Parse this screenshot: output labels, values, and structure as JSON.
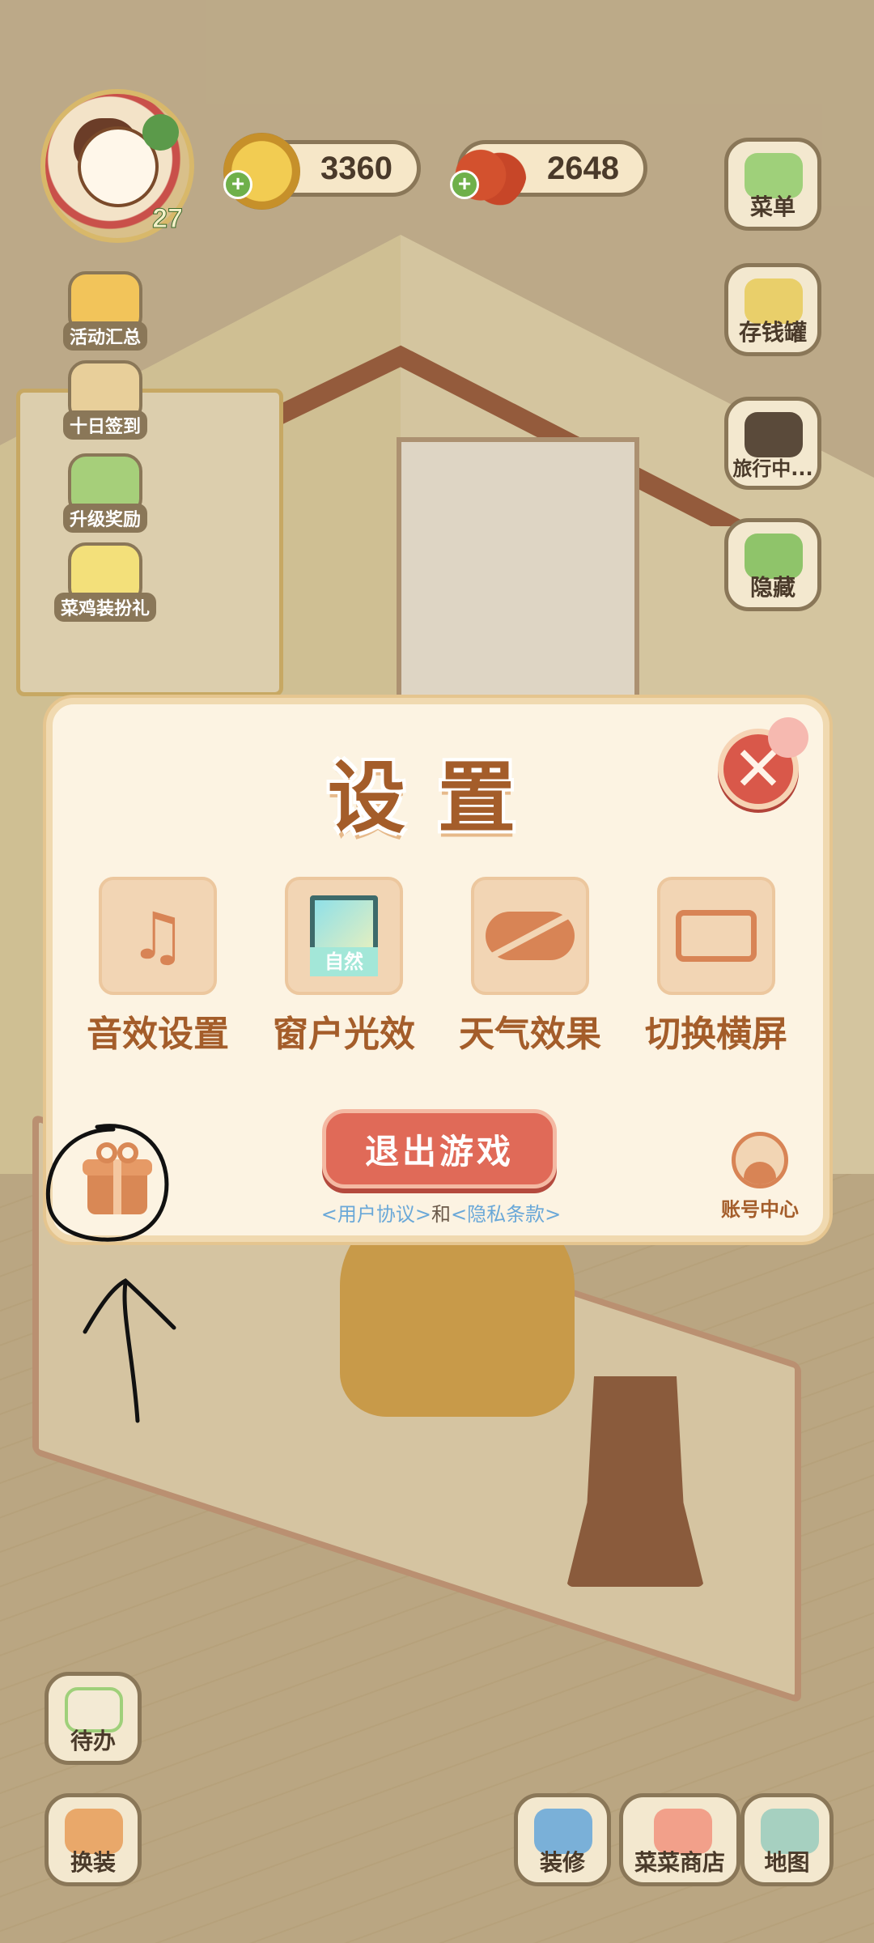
{
  "hud": {
    "player_level": "27",
    "coins": "3360",
    "veggies": "2648",
    "plus": "+"
  },
  "left_menu": [
    {
      "label": "活动汇总"
    },
    {
      "label": "十日签到"
    },
    {
      "label": "升级奖励"
    },
    {
      "label": "菜鸡装扮礼"
    }
  ],
  "right_menu": [
    {
      "label": "菜单"
    },
    {
      "label": "存钱罐"
    },
    {
      "label": "旅行中..."
    },
    {
      "label": "隐藏"
    }
  ],
  "bottom_left": [
    {
      "label": "待办"
    },
    {
      "label": "换装"
    }
  ],
  "bottom_right": [
    {
      "label": "装修"
    },
    {
      "label": "菜菜商店"
    },
    {
      "label": "地图"
    }
  ],
  "settings": {
    "title": "设置",
    "close_symbol": "✕",
    "options": [
      {
        "label": "音效设置",
        "icon": "music-note-icon"
      },
      {
        "label": "窗户光效",
        "icon": "window-icon",
        "badge": "自然"
      },
      {
        "label": "天气效果",
        "icon": "cloud-off-icon"
      },
      {
        "label": "切换横屏",
        "icon": "rotate-screen-icon"
      }
    ],
    "quit_label": "退出游戏",
    "user_agreement": "<用户协议>",
    "and_text": "和",
    "privacy_policy": "<隐私条款>",
    "account_label": "账号中心"
  },
  "colors": {
    "accent": "#a45d2a",
    "quit_button": "#e06a58",
    "close_button": "#d9584a",
    "link": "#6aa8d8"
  }
}
